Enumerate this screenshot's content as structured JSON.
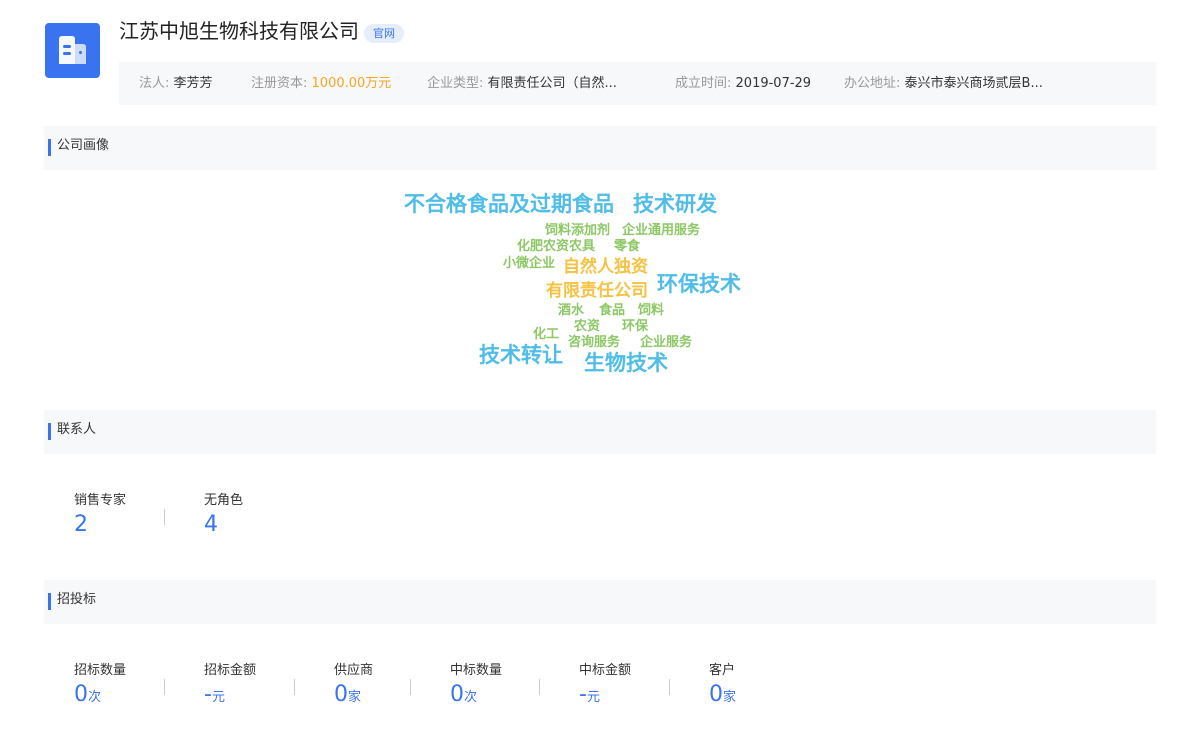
{
  "header": {
    "company_name": "江苏中旭生物科技有限公司",
    "official_tag": "官网",
    "logo_icon": "building-icon",
    "accent_color": "#3a73f0"
  },
  "info": [
    {
      "key": "法人:",
      "value": "李芳芳"
    },
    {
      "key": "注册资本:",
      "value": "1000.00万元"
    },
    {
      "key": "企业类型:",
      "value": "有限责任公司（自然..."
    },
    {
      "key": "成立时间:",
      "value": "2019-07-29"
    },
    {
      "key": "办公地址:",
      "value": "泰兴市泰兴商场贰层B..."
    }
  ],
  "sections": {
    "profile": "公司画像",
    "contacts": "联系人",
    "bidding": "招投标"
  },
  "word_cloud": [
    {
      "text": "不合格食品及过期食品",
      "color": "blue"
    },
    {
      "text": "技术研发",
      "color": "blue"
    },
    {
      "text": "饲料添加剂",
      "color": "green"
    },
    {
      "text": "企业通用服务",
      "color": "green"
    },
    {
      "text": "化肥农资农具",
      "color": "green"
    },
    {
      "text": "零食",
      "color": "green"
    },
    {
      "text": "小微企业",
      "color": "green"
    },
    {
      "text": "自然人独资",
      "color": "yellow"
    },
    {
      "text": "有限责任公司",
      "color": "yellow"
    },
    {
      "text": "环保技术",
      "color": "blue"
    },
    {
      "text": "酒水",
      "color": "green"
    },
    {
      "text": "食品",
      "color": "green"
    },
    {
      "text": "饲料",
      "color": "green"
    },
    {
      "text": "化工",
      "color": "green"
    },
    {
      "text": "农资",
      "color": "green"
    },
    {
      "text": "环保",
      "color": "green"
    },
    {
      "text": "咨询服务",
      "color": "green"
    },
    {
      "text": "企业服务",
      "color": "green"
    },
    {
      "text": "技术转让",
      "color": "blue"
    },
    {
      "text": "生物技术",
      "color": "blue"
    }
  ],
  "contacts": [
    {
      "label": "销售专家",
      "value": "2"
    },
    {
      "label": "无角色",
      "value": "4"
    }
  ],
  "bidding": [
    {
      "label": "招标数量",
      "value": "0",
      "unit": "次"
    },
    {
      "label": "招标金额",
      "value": "-",
      "unit": "元"
    },
    {
      "label": "供应商",
      "value": "0",
      "unit": "家"
    },
    {
      "label": "中标数量",
      "value": "0",
      "unit": "次"
    },
    {
      "label": "中标金额",
      "value": "-",
      "unit": "元"
    },
    {
      "label": "客户",
      "value": "0",
      "unit": "家"
    }
  ]
}
